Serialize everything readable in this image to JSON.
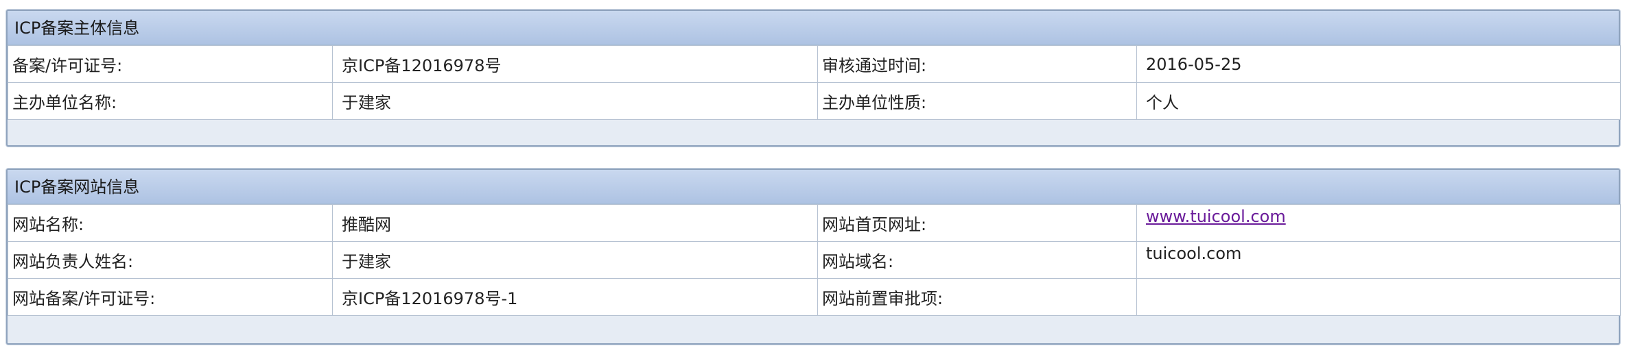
{
  "subject_panel": {
    "title": "ICP备案主体信息",
    "rows": [
      {
        "label1": "备案/许可证号:",
        "value1": "京ICP备12016978号",
        "label2": "审核通过时间:",
        "value2": "2016-05-25"
      },
      {
        "label1": "主办单位名称:",
        "value1": "于建家",
        "label2": "主办单位性质:",
        "value2": "个人"
      }
    ]
  },
  "website_panel": {
    "title": "ICP备案网站信息",
    "rows": [
      {
        "label1": "网站名称:",
        "value1": "推酷网",
        "label2": "网站首页网址:",
        "value2": "www.tuicool.com"
      },
      {
        "label1": "网站负责人姓名:",
        "value1": "于建家",
        "label2": "网站域名:",
        "value2": "tuicool.com"
      },
      {
        "label1": "网站备案/许可证号:",
        "value1": "京ICP备12016978号-1",
        "label2": "网站前置审批项:",
        "value2": ""
      }
    ]
  }
}
